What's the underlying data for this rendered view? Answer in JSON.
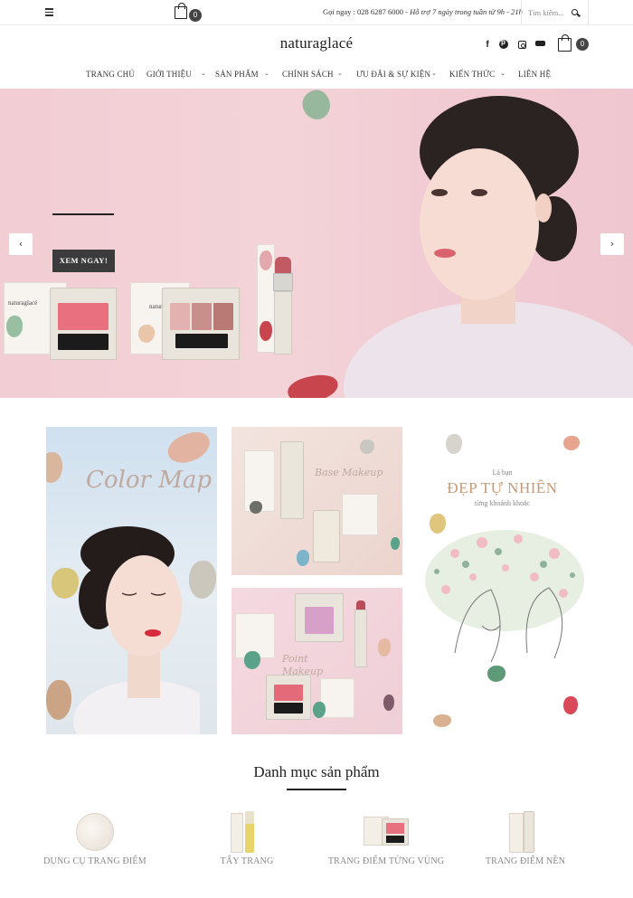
{
  "topbar": {
    "cart_count": "0",
    "hotline_label": "Gọi ngay : 028 6287 6000 - ",
    "hotline_hours": "Hỗ trợ 7 ngày trong tuần từ 9h - 21h",
    "search_placeholder": "Tìm kiếm..."
  },
  "header": {
    "logo": "naturaglacé",
    "cart_count": "0"
  },
  "nav": {
    "items": [
      {
        "label": "TRANG CHỦ"
      },
      {
        "label": "GIỚI THIỆU"
      },
      {
        "label": "SẢN PHẨM"
      },
      {
        "label": "CHÍNH SÁCH"
      },
      {
        "label": "ƯU ĐÃI & SỰ KIỆN"
      },
      {
        "label": "KIẾN THỨC"
      },
      {
        "label": "LIÊN HỆ"
      }
    ]
  },
  "hero": {
    "cta_label": "XEM NGAY!",
    "brand_on_box": "naturaglacé"
  },
  "collage": {
    "colormap_script": "Color Map",
    "base_script": "Base Makeup",
    "point_script": "Point Makeup",
    "natural_small_top": "Là bạn",
    "natural_title": "ĐẸP TỰ NHIÊN",
    "natural_small_bottom": "từng khoảnh khoắc"
  },
  "categories": {
    "title": "Danh mục sản phẩm",
    "items": [
      {
        "label": "DỤNG CỤ TRANG ĐIỂM"
      },
      {
        "label": "TẨY TRANG"
      },
      {
        "label": "TRANG ĐIỂM TỪNG VÙNG"
      },
      {
        "label": "TRANG ĐIỂM NỀN"
      }
    ]
  },
  "colors": {
    "hero_bg": "#f2cdd4",
    "cta_bg": "#3b3b3b",
    "accent_gold": "#c79a74"
  },
  "icons": [
    "menu-icon",
    "shopping-bag-icon",
    "search-icon",
    "facebook-icon",
    "pinterest-icon",
    "instagram-icon",
    "youtube-icon",
    "chevron-left-icon",
    "chevron-right-icon",
    "chevron-down-icon"
  ]
}
